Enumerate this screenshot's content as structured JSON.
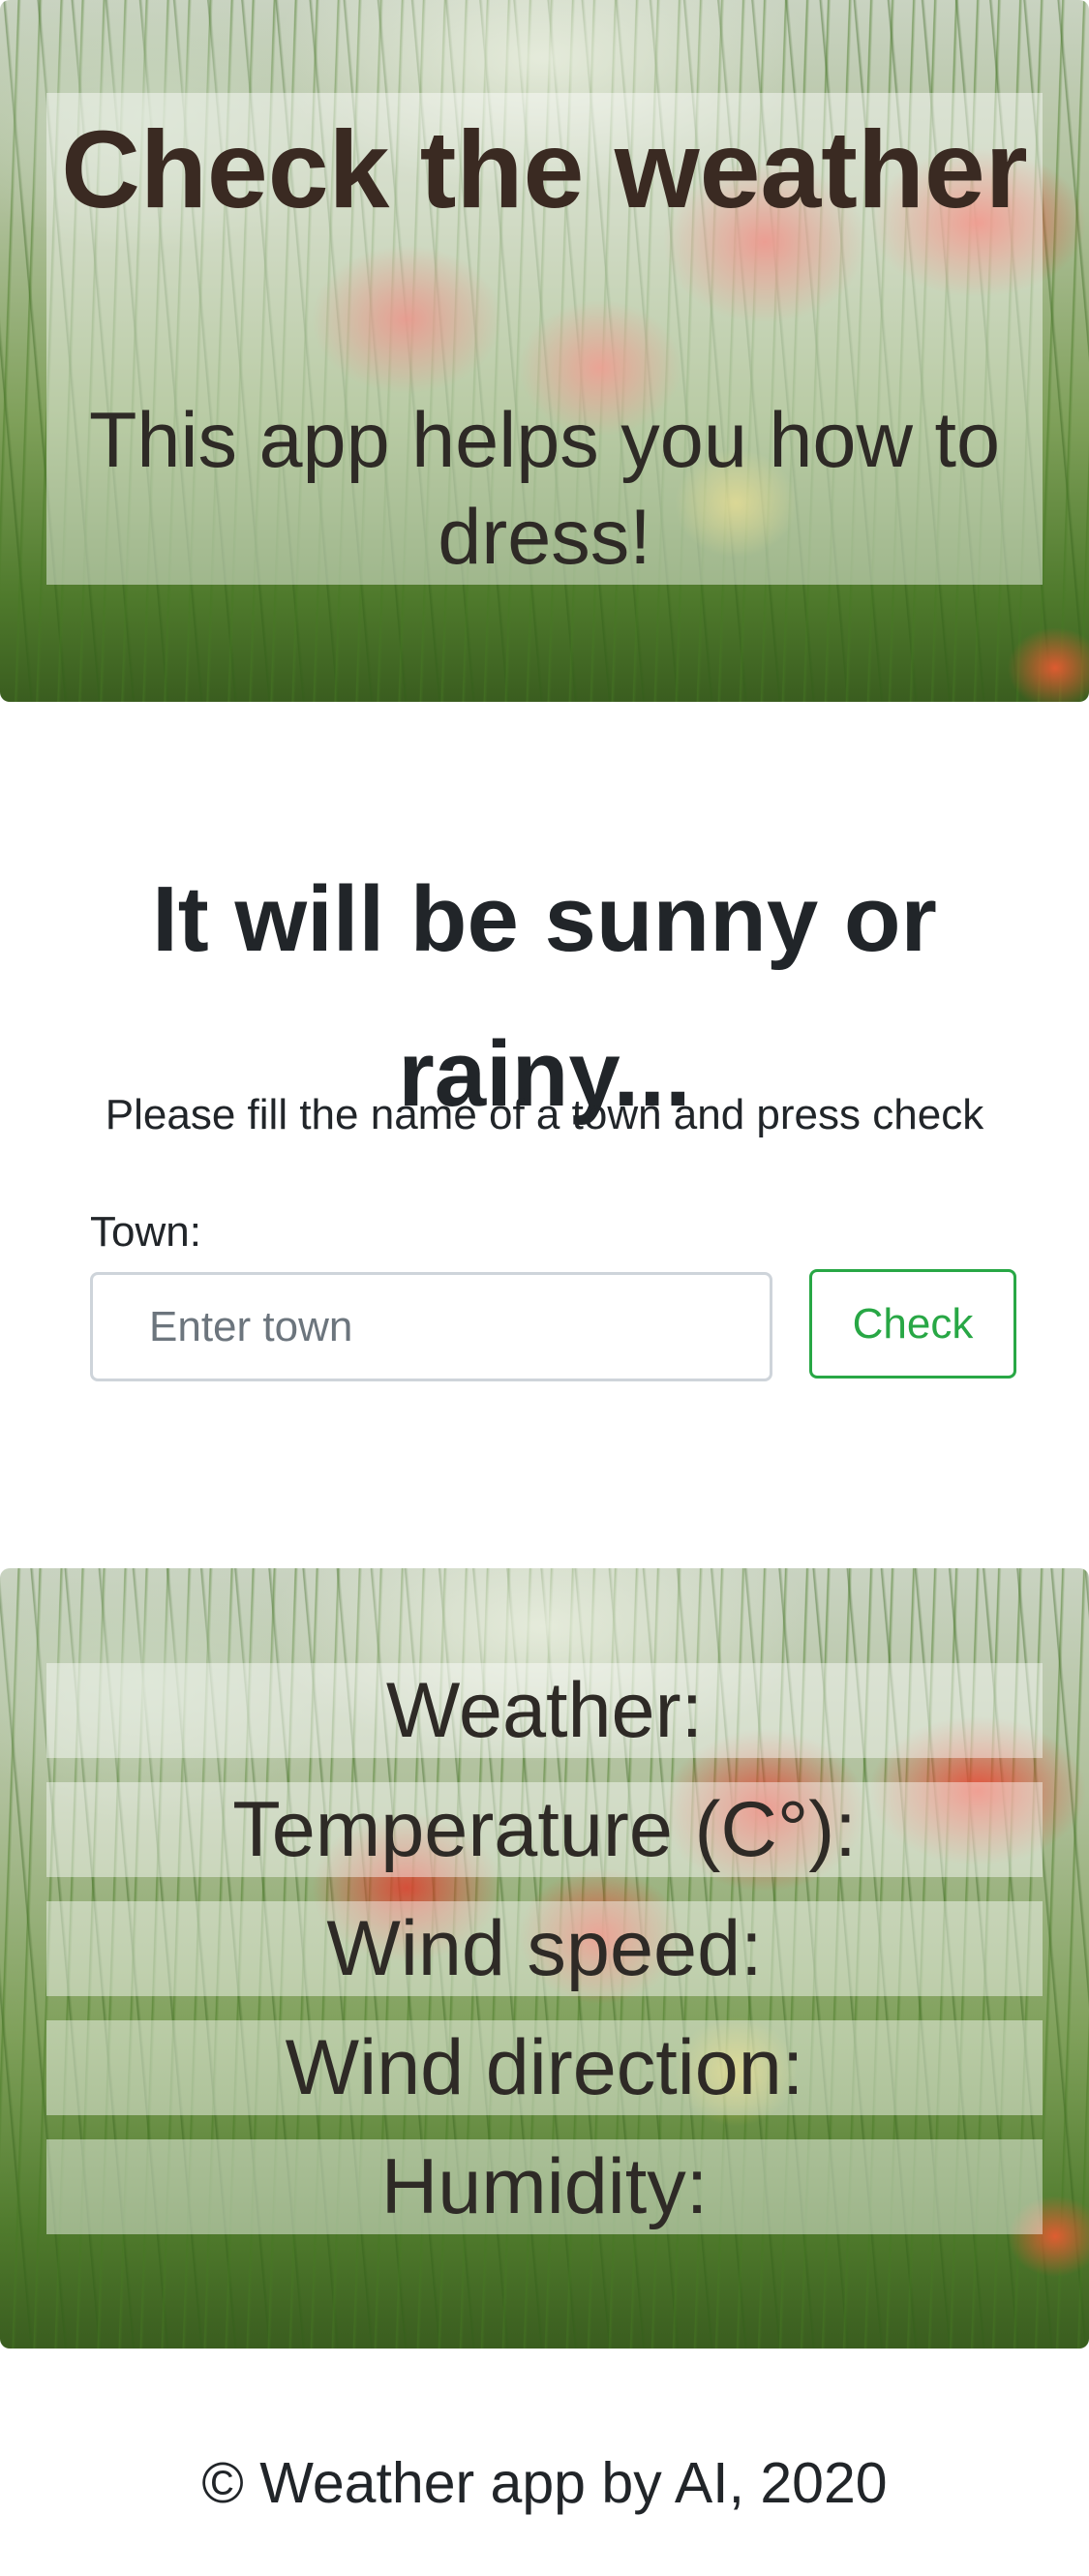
{
  "header": {
    "title": "Check the weather",
    "subtitle": "This app helps you how to dress!"
  },
  "main": {
    "heading": "It will be sunny or rainy...",
    "instruction": "Please fill the name of a town and press check",
    "form": {
      "town_label": "Town:",
      "town_placeholder": "Enter town",
      "town_value": "",
      "check_label": "Check"
    }
  },
  "results": {
    "weather_label": "Weather:",
    "temperature_label": "Temperature (C°):",
    "wind_speed_label": "Wind speed:",
    "wind_direction_label": "Wind direction:",
    "humidity_label": "Humidity:"
  },
  "footer": {
    "text": "© Weather app by AI, 2020"
  },
  "colors": {
    "accent_green": "#28a745",
    "input_border": "#ced4da",
    "text": "#212529"
  }
}
